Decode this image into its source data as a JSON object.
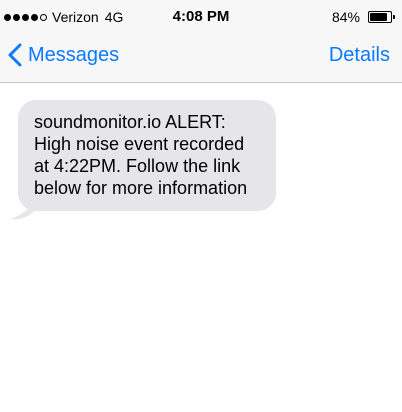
{
  "status_bar": {
    "carrier": "Verizon",
    "network": "4G",
    "time": "4:08 PM",
    "battery_percent_label": "84%",
    "battery_level": 0.84,
    "signal_bars_filled": 4,
    "signal_bars_total": 5
  },
  "nav": {
    "back_label": "Messages",
    "details_label": "Details"
  },
  "messages": [
    {
      "direction": "incoming",
      "text": "soundmonitor.io ALERT: High noise event recorded at 4:22PM. Follow the link below for more information"
    }
  ],
  "colors": {
    "accent": "#0a7aff",
    "bubble_incoming": "#e5e5ea",
    "bar_background": "#f7f7f7"
  },
  "icons": {
    "back": "chevron-left-icon",
    "battery": "battery-icon",
    "signal": "signal-dots-icon"
  }
}
